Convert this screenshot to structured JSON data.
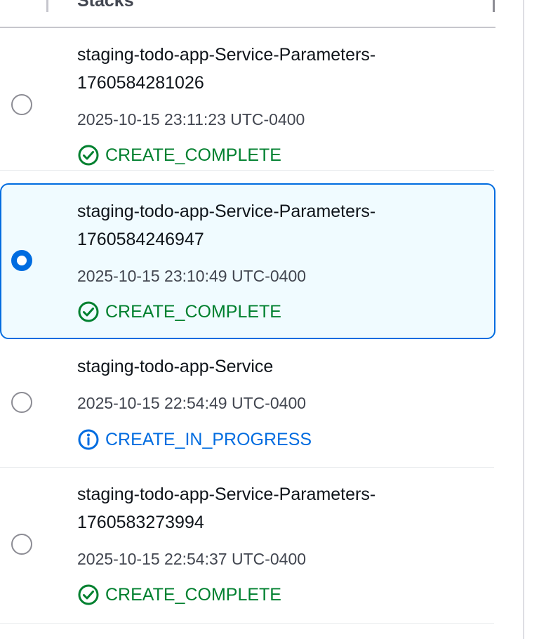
{
  "header": {
    "title": "Stacks"
  },
  "colors": {
    "selected_border": "#006ce0",
    "selected_background": "#f0fbff",
    "success": "#00802f",
    "info": "#006ce0"
  },
  "stacks": [
    {
      "name": "staging-todo-app-Service-Parameters-\n1760584281026",
      "timestamp": "2025-10-15 23:11:23 UTC-0400",
      "status": "CREATE_COMPLETE",
      "status_icon": "check-circle-icon",
      "selected": false
    },
    {
      "name": "staging-todo-app-Service-Parameters-\n1760584246947",
      "timestamp": "2025-10-15 23:10:49 UTC-0400",
      "status": "CREATE_COMPLETE",
      "status_icon": "check-circle-icon",
      "selected": true
    },
    {
      "name": "staging-todo-app-Service",
      "timestamp": "2025-10-15 22:54:49 UTC-0400",
      "status": "CREATE_IN_PROGRESS",
      "status_icon": "info-circle-icon",
      "selected": false
    },
    {
      "name": "staging-todo-app-Service-Parameters-\n1760583273994",
      "timestamp": "2025-10-15 22:54:37 UTC-0400",
      "status": "CREATE_COMPLETE",
      "status_icon": "check-circle-icon",
      "selected": false
    }
  ]
}
